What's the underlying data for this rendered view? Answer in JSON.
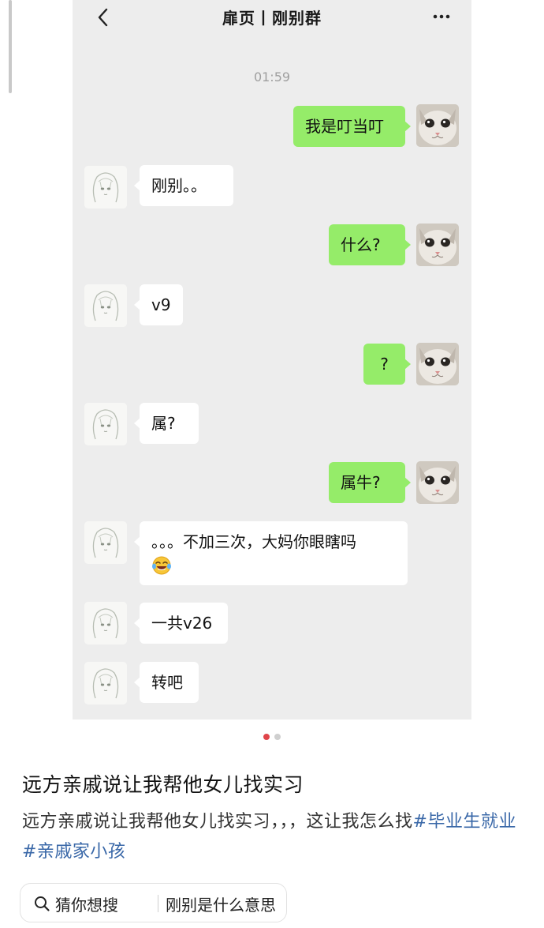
{
  "chat": {
    "title": "扉页丨刚别群",
    "time": "01:59",
    "messages": [
      {
        "from": "me",
        "text": "我是叮当叮"
      },
      {
        "from": "them",
        "text": "刚别。。"
      },
      {
        "from": "me",
        "text": "什么?"
      },
      {
        "from": "them",
        "text": "v9"
      },
      {
        "from": "me",
        "text": "?"
      },
      {
        "from": "them",
        "text": "属?"
      },
      {
        "from": "me",
        "text": "属牛?"
      },
      {
        "from": "them",
        "text": "。。。不加三次，大妈你眼瞎吗",
        "emoji": "laughing-tears-emoji"
      },
      {
        "from": "them",
        "text": "一共v26"
      },
      {
        "from": "them",
        "text": "转吧"
      }
    ]
  },
  "pager": {
    "current": 1,
    "total": 2
  },
  "post": {
    "title": "远方亲戚说让我帮他女儿找实习",
    "body": "远方亲戚说让我帮他女儿找实习，，，这让我怎么找",
    "tags": [
      "#毕业生就业",
      "#亲戚家小孩"
    ]
  },
  "search": {
    "prefix": "猜你想搜",
    "query": "刚别是什么意思"
  },
  "colors": {
    "chat_bg": "#ededed",
    "my_bubble": "#95ec69",
    "their_bubble": "#ffffff",
    "tag_link": "#3a68a8",
    "pager_active": "#e0454a"
  }
}
